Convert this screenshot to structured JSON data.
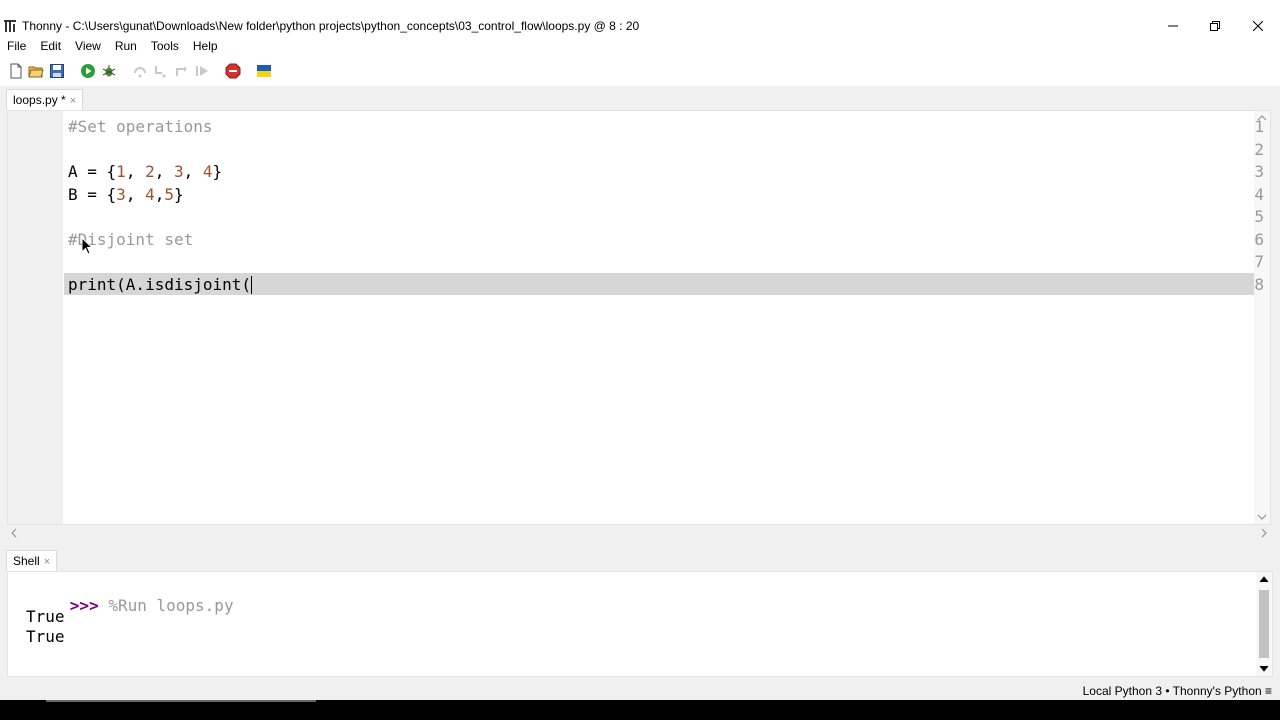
{
  "window": {
    "app_name": "Thonny",
    "title": "Thonny  -  C:\\Users\\gunat\\Downloads\\New folder\\python projects\\python_concepts\\03_control_flow\\loops.py  @  8 : 20"
  },
  "menu": [
    "File",
    "Edit",
    "View",
    "Run",
    "Tools",
    "Help"
  ],
  "toolbar": {
    "icons": [
      "new-file",
      "open-file",
      "save",
      "run",
      "debug",
      "step-over",
      "step-into",
      "step-out",
      "resume",
      "stop",
      "ukraine-flag"
    ]
  },
  "editor": {
    "tab_label": "loops.py *",
    "tab_close": "×",
    "lines": [
      {
        "no": "1",
        "parts": [
          {
            "t": "#Set operations",
            "c": "cm"
          }
        ]
      },
      {
        "no": "2",
        "parts": []
      },
      {
        "no": "3",
        "parts": [
          {
            "t": "A = {",
            "c": ""
          },
          {
            "t": "1",
            "c": "num"
          },
          {
            "t": ", ",
            "c": ""
          },
          {
            "t": "2",
            "c": "num"
          },
          {
            "t": ", ",
            "c": ""
          },
          {
            "t": "3",
            "c": "num"
          },
          {
            "t": ", ",
            "c": ""
          },
          {
            "t": "4",
            "c": "num"
          },
          {
            "t": "}",
            "c": ""
          }
        ]
      },
      {
        "no": "4",
        "parts": [
          {
            "t": "B = {",
            "c": ""
          },
          {
            "t": "3",
            "c": "num"
          },
          {
            "t": ", ",
            "c": ""
          },
          {
            "t": "4",
            "c": "num"
          },
          {
            "t": ",",
            "c": ""
          },
          {
            "t": "5",
            "c": "num"
          },
          {
            "t": "}",
            "c": ""
          }
        ]
      },
      {
        "no": "5",
        "parts": []
      },
      {
        "no": "6",
        "parts": [
          {
            "t": "#Disjoint set",
            "c": "cm"
          }
        ]
      },
      {
        "no": "7",
        "parts": []
      },
      {
        "no": "8",
        "parts": [
          {
            "t": "print(A.isdisjoint(",
            "c": ""
          }
        ]
      }
    ],
    "current_line": "8"
  },
  "shell": {
    "tab_label": "Shell",
    "tab_close": "×",
    "prompt": ">>>",
    "command": "%Run loops.py",
    "output": [
      "True",
      "True"
    ],
    "final_prompt": ">>>"
  },
  "status": {
    "text": "Local Python 3  •  Thonny's Python  ≡"
  },
  "colors": {
    "prompt": "#800080",
    "comment": "#999999",
    "number": "#a0522d",
    "current_line": "#d6d6d6"
  }
}
